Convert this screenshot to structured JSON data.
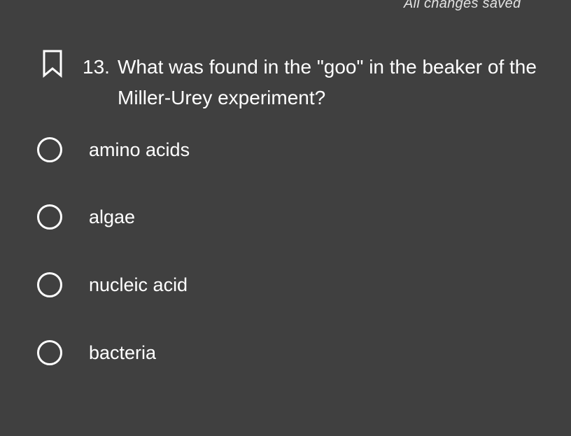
{
  "header": {
    "save_status": "All changes saved"
  },
  "question": {
    "number": "13.",
    "text_line1": "What was found in the \"goo\" in the beaker of the",
    "text_line2": "Miller-Urey experiment?",
    "bookmark_icon": "bookmark-outline-icon"
  },
  "options": [
    {
      "label": "amino acids",
      "selected": false
    },
    {
      "label": "algae",
      "selected": false
    },
    {
      "label": "nucleic acid",
      "selected": false
    },
    {
      "label": "bacteria",
      "selected": false
    }
  ],
  "colors": {
    "background": "#404040",
    "text": "#ffffff",
    "status_text": "#e2e2e2"
  }
}
